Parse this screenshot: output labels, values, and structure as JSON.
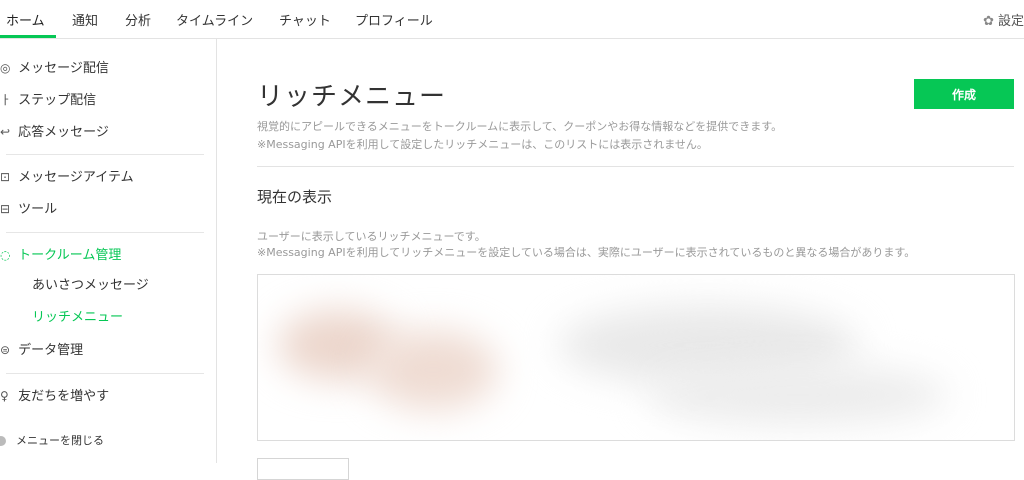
{
  "topnav": {
    "tabs": [
      {
        "label": "ホーム",
        "active": true
      },
      {
        "label": "通知"
      },
      {
        "label": "分析"
      },
      {
        "label": "タイムライン"
      },
      {
        "label": "チャット"
      },
      {
        "label": "プロフィール"
      }
    ],
    "settings_label": "設定",
    "accent": "#06c755"
  },
  "sidebar": {
    "items": [
      {
        "label": "メッセージ配信",
        "icon": "broadcast-icon"
      },
      {
        "label": "ステップ配信",
        "icon": "step-icon"
      },
      {
        "label": "応答メッセージ",
        "icon": "reply-icon"
      },
      {
        "label": "メッセージアイテム",
        "icon": "message-item-icon"
      },
      {
        "label": "ツール",
        "icon": "tool-icon"
      },
      {
        "label": "トークルーム管理",
        "icon": "talkroom-icon",
        "active": true
      },
      {
        "label": "データ管理",
        "icon": "data-icon"
      },
      {
        "label": "友だちを増やす",
        "icon": "add-friend-icon"
      }
    ],
    "subitems": [
      {
        "label": "あいさつメッセージ"
      },
      {
        "label": "リッチメニュー",
        "active": true
      }
    ],
    "close_label": "メニューを閉じる"
  },
  "main": {
    "title": "リッチメニュー",
    "create_label": "作成",
    "desc_line1": "視覚的にアピールできるメニューをトークルームに表示して、クーポンやお得な情報などを提供できます。",
    "desc_line2": "※Messaging APIを利用して設定したリッチメニューは、このリストには表示されません。",
    "section_title": "現在の表示",
    "section_desc1": "ユーザーに表示しているリッチメニューです。",
    "section_desc2": "※Messaging APIを利用してリッチメニューを設定している場合は、実際にユーザーに表示されているものと異なる場合があります。"
  }
}
